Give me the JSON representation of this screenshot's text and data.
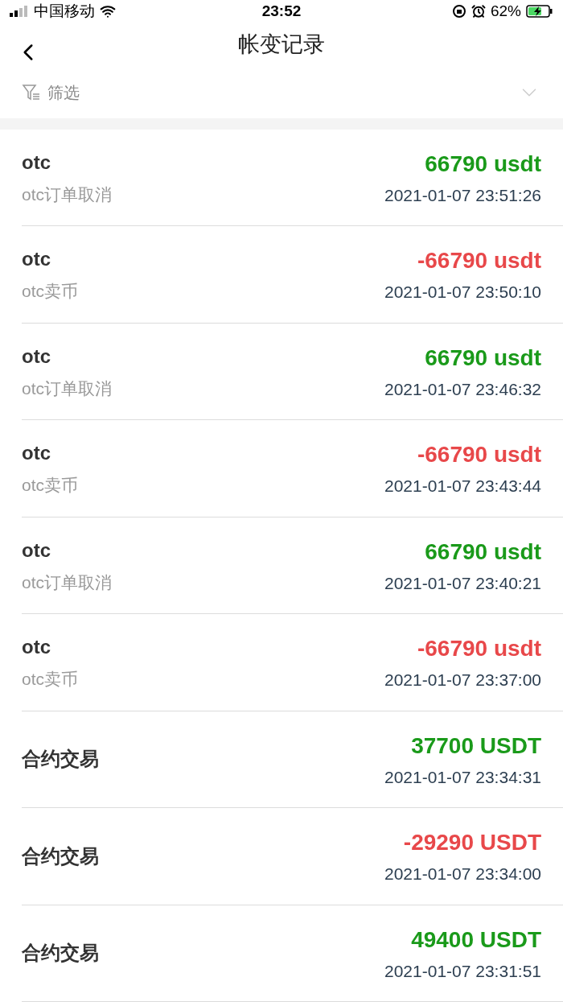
{
  "status_bar": {
    "carrier": "中国移动",
    "time": "23:52",
    "battery": "62%"
  },
  "header": {
    "title": "帐变记录"
  },
  "filter": {
    "label": "筛选"
  },
  "records": [
    {
      "title": "otc",
      "subtitle": "otc订单取消",
      "amount": "66790 usdt",
      "kind": "credit",
      "time": "2021-01-07 23:51:26"
    },
    {
      "title": "otc",
      "subtitle": "otc卖币",
      "amount": "-66790 usdt",
      "kind": "debit",
      "time": "2021-01-07 23:50:10"
    },
    {
      "title": "otc",
      "subtitle": "otc订单取消",
      "amount": "66790 usdt",
      "kind": "credit",
      "time": "2021-01-07 23:46:32"
    },
    {
      "title": "otc",
      "subtitle": "otc卖币",
      "amount": "-66790 usdt",
      "kind": "debit",
      "time": "2021-01-07 23:43:44"
    },
    {
      "title": "otc",
      "subtitle": "otc订单取消",
      "amount": "66790 usdt",
      "kind": "credit",
      "time": "2021-01-07 23:40:21"
    },
    {
      "title": "otc",
      "subtitle": "otc卖币",
      "amount": "-66790 usdt",
      "kind": "debit",
      "time": "2021-01-07 23:37:00"
    },
    {
      "title": "合约交易",
      "amount": "37700 USDT",
      "kind": "credit",
      "time": "2021-01-07 23:34:31"
    },
    {
      "title": "合约交易",
      "amount": "-29290 USDT",
      "kind": "debit",
      "time": "2021-01-07 23:34:00"
    },
    {
      "title": "合约交易",
      "amount": "49400 USDT",
      "kind": "credit",
      "time": "2021-01-07 23:31:51"
    }
  ]
}
